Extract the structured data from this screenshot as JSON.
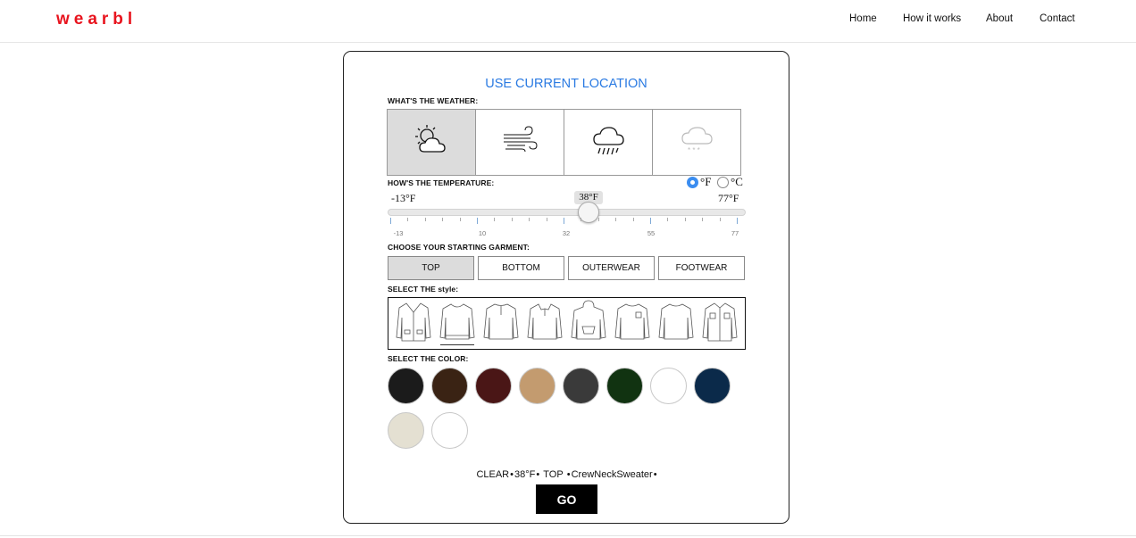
{
  "header": {
    "logo": "wearbl",
    "nav": [
      "Home",
      "How it works",
      "About",
      "Contact"
    ]
  },
  "card": {
    "location_link": "USE CURRENT LOCATION",
    "weather_label": "WHAT'S THE WEATHER:",
    "weather_options": [
      {
        "icon": "partly-cloudy-icon",
        "selected": true
      },
      {
        "icon": "wind-icon",
        "selected": false
      },
      {
        "icon": "rain-icon",
        "selected": false
      },
      {
        "icon": "snow-icon",
        "selected": false
      }
    ],
    "temperature_label": "HOW'S THE TEMPERATURE:",
    "unit_f": "°F",
    "unit_c": "°C",
    "unit_selected": "°F",
    "temp_min": "-13°F",
    "temp_max": "77°F",
    "temp_current": "38°F",
    "temp_value": 38,
    "temp_range": [
      -13,
      77
    ],
    "tick_labels": [
      "-13",
      "10",
      "32",
      "55",
      "77"
    ],
    "garment_label": "CHOOSE YOUR STARTING GARMENT:",
    "garments": [
      "TOP",
      "BOTTOM",
      "OUTERWEAR",
      "FOOTWEAR"
    ],
    "garment_selected": "TOP",
    "style_label": "SELECT THE style:",
    "styles": [
      "cardigan-icon",
      "crew-neck-sweater-icon",
      "henley-icon",
      "polo-sweater-icon",
      "hoodie-icon",
      "pocket-tee-icon",
      "long-sleeve-tee-icon",
      "button-shirt-icon"
    ],
    "style_selected": "crew-neck-sweater-icon",
    "color_label": "SELECT THE COLOR:",
    "colors": [
      "#1b1b1b",
      "#3a2314",
      "#4a1616",
      "#c39b6f",
      "#3a3a3a",
      "#113311",
      "#ffffff",
      "#0b2a4a",
      "#e4e0d2",
      "#ffffff"
    ],
    "summary": [
      "CLEAR",
      "38°F",
      "TOP",
      "CrewNeckSweater"
    ],
    "go_label": "GO"
  }
}
